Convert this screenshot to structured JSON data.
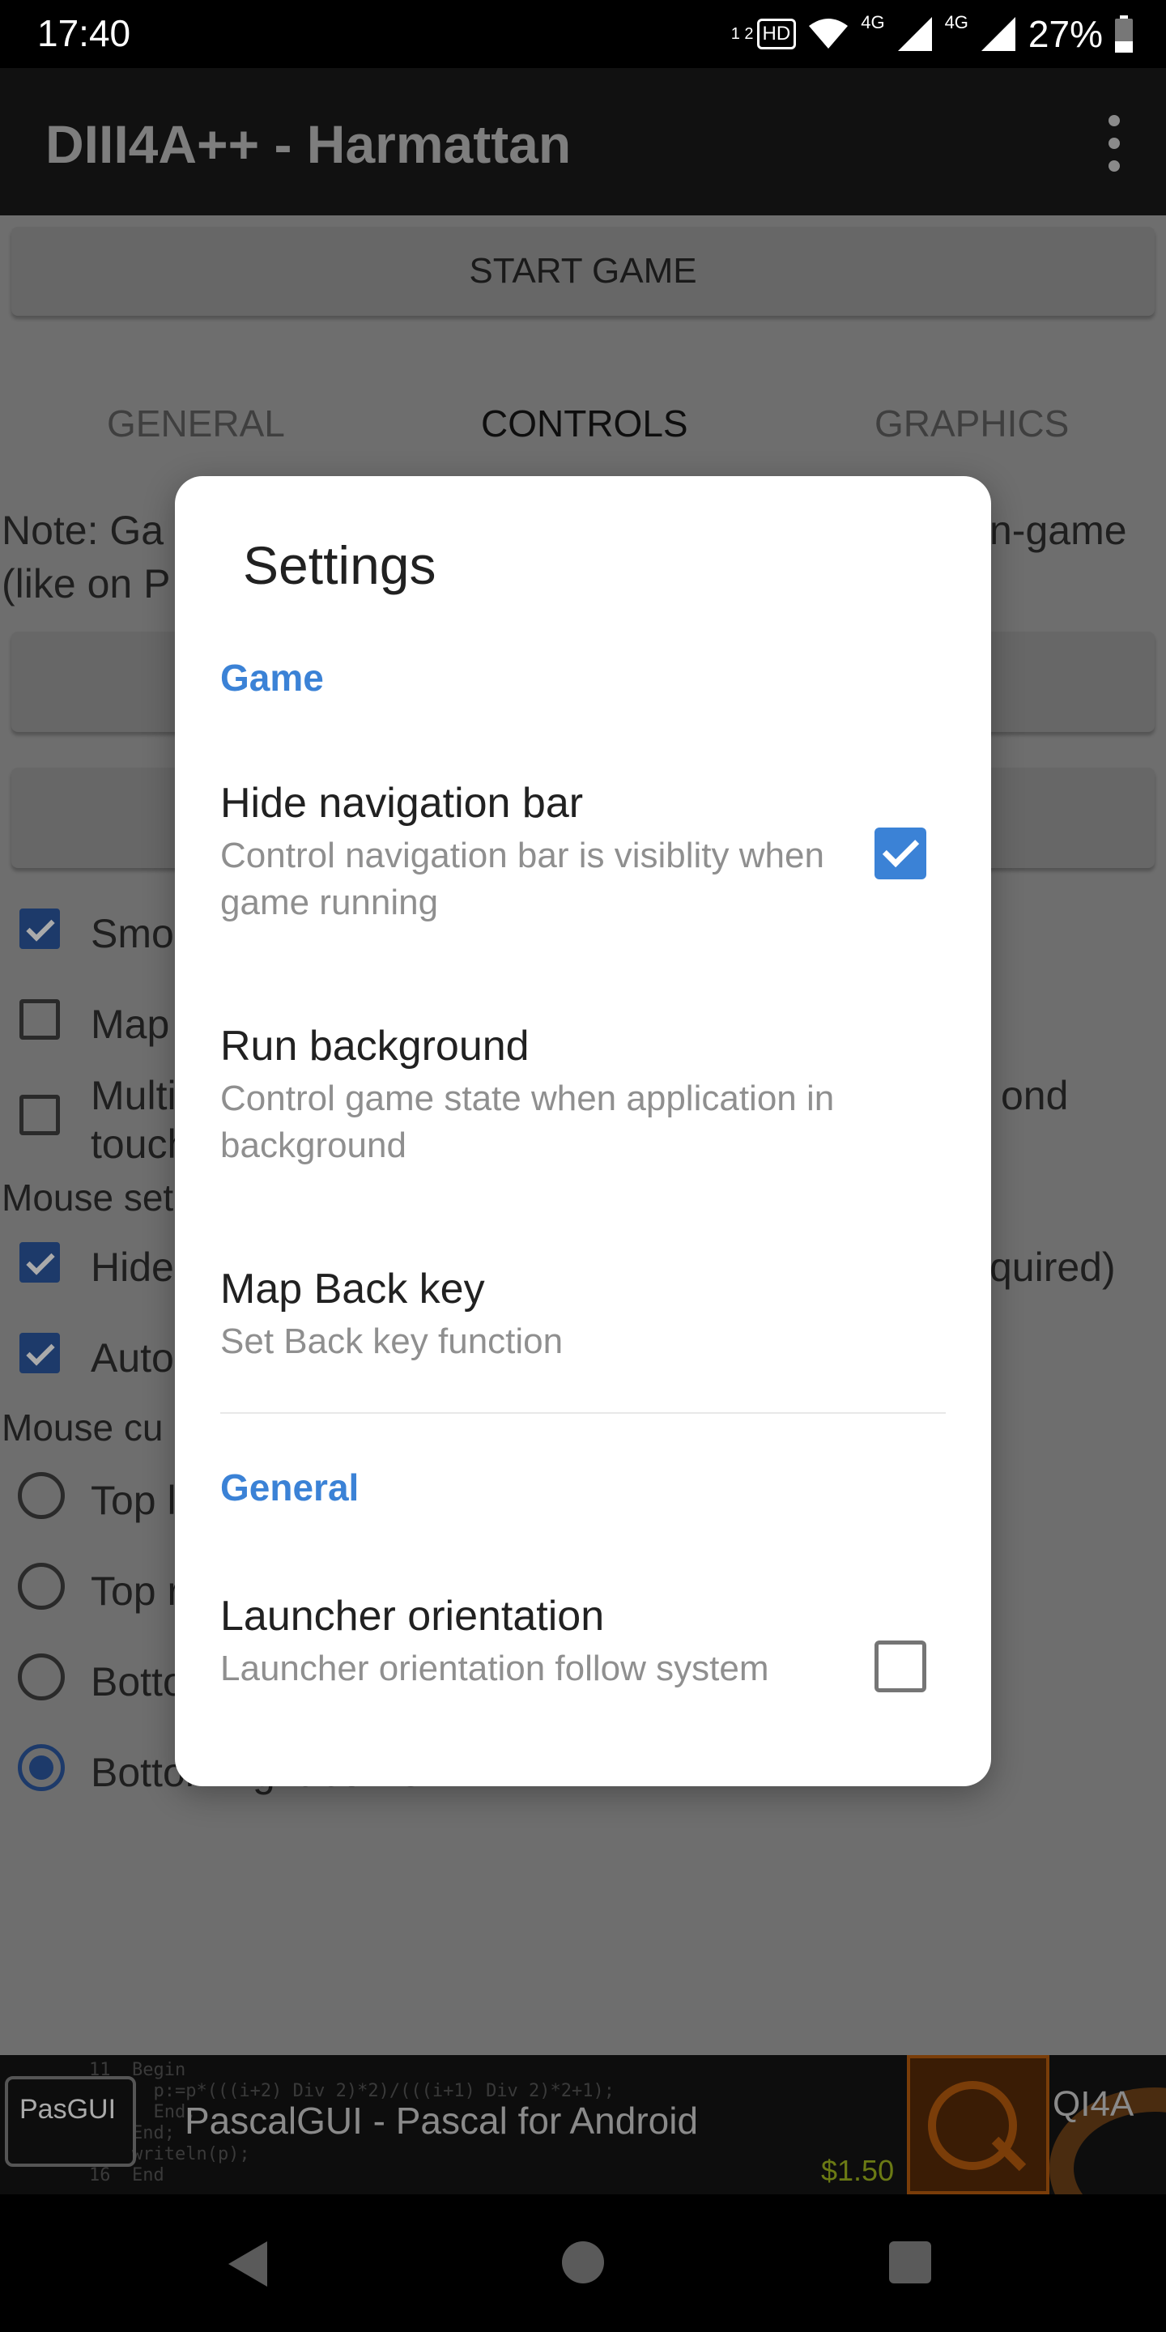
{
  "status_bar": {
    "time": "17:40",
    "hd_label": "HD",
    "sim_label": "1 2",
    "network_1": "4G",
    "network_2": "4G",
    "battery": "27%",
    "icons": [
      "hd-voice-icon",
      "wifi-icon",
      "signal-icon",
      "signal-icon",
      "battery-icon"
    ]
  },
  "app_bar": {
    "title": "DIII4A++ - Harmattan",
    "menu_icon": "more-vert-icon"
  },
  "background": {
    "start_button": "START GAME",
    "tabs": [
      "GENERAL",
      "CONTROLS",
      "GRAPHICS"
    ],
    "active_tab": "CONTROLS",
    "note_left_1": "Note: Ga",
    "note_left_2": "(like on P",
    "note_right": "n-game",
    "checkbox_rows": [
      {
        "label": "Smoo",
        "checked": true
      },
      {
        "label": "Map",
        "checked": false
      },
      {
        "label": "Multi",
        "label2": "touch",
        "right": "ond",
        "checked": false
      }
    ],
    "mouse_settings_label": "Mouse set",
    "mouse_rows": [
      {
        "label": "Hide",
        "right": "quired)",
        "checked": true
      },
      {
        "label": "Auto",
        "checked": true
      }
    ],
    "mouse_cursor_label": "Mouse cu",
    "radio_rows": [
      {
        "label": "Top l",
        "selected": false
      },
      {
        "label": "Top r",
        "selected": false
      },
      {
        "label": "Botto",
        "selected": false
      },
      {
        "label": "Bottom right corner",
        "selected": true
      }
    ]
  },
  "dialog": {
    "title": "Settings",
    "categories": [
      {
        "label": "Game",
        "prefs": [
          {
            "title": "Hide navigation bar",
            "summary": "Control navigation bar is visiblity when game running",
            "checkbox": true,
            "checked": true
          },
          {
            "title": "Run background",
            "summary": "Control game state when application in background",
            "checkbox": false
          },
          {
            "title": "Map Back key",
            "summary": "Set Back key function",
            "checkbox": false
          }
        ]
      },
      {
        "label": "General",
        "prefs": [
          {
            "title": "Launcher orientation",
            "summary": "Launcher orientation follow system",
            "checkbox": true,
            "checked": false
          }
        ]
      }
    ]
  },
  "ad": {
    "logo_text": "PasGUI",
    "title": "PascalGUI - Pascal for Android",
    "price": "$1.50",
    "right_text": "QI4A",
    "code_lines": [
      "11  Begin",
      "      p:=p*(((i+2) Div 2)*2)/(((i+1) Div 2)*2+1);",
      "      End;",
      "    End;",
      "    writeln(p);",
      "16  End"
    ]
  },
  "nav_bar": {
    "icons": [
      "back-icon",
      "home-icon",
      "recents-icon"
    ]
  }
}
